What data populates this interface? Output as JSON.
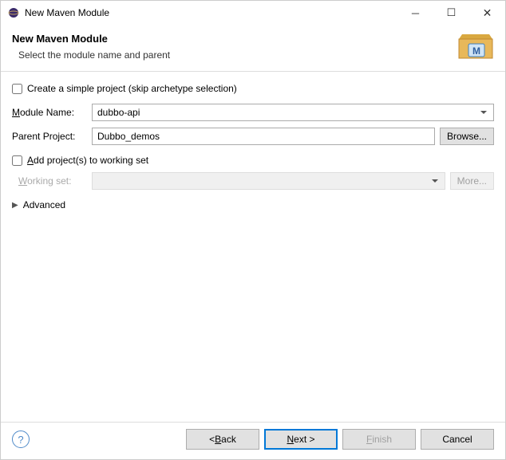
{
  "titlebar": {
    "title": "New Maven Module"
  },
  "header": {
    "title": "New Maven Module",
    "subtitle": "Select the module name and parent"
  },
  "form": {
    "simple_project_label": "Create a simple project (skip archetype selection)",
    "module_name_label_pre": "M",
    "module_name_label_post": "odule Name:",
    "module_name_value": "dubbo-api",
    "parent_project_label": "Parent Project:",
    "parent_project_value": "Dubbo_demos",
    "browse_label": "Browse...",
    "add_working_set_pre": "A",
    "add_working_set_post": "dd project(s) to working set",
    "working_set_label_pre": "W",
    "working_set_label_post": "orking set:",
    "more_label": "More...",
    "advanced_label": "Advanced"
  },
  "footer": {
    "back_pre": "< ",
    "back_u": "B",
    "back_post": "ack",
    "next_u": "N",
    "next_post": "ext >",
    "finish_u": "F",
    "finish_post": "inish",
    "cancel": "Cancel"
  }
}
